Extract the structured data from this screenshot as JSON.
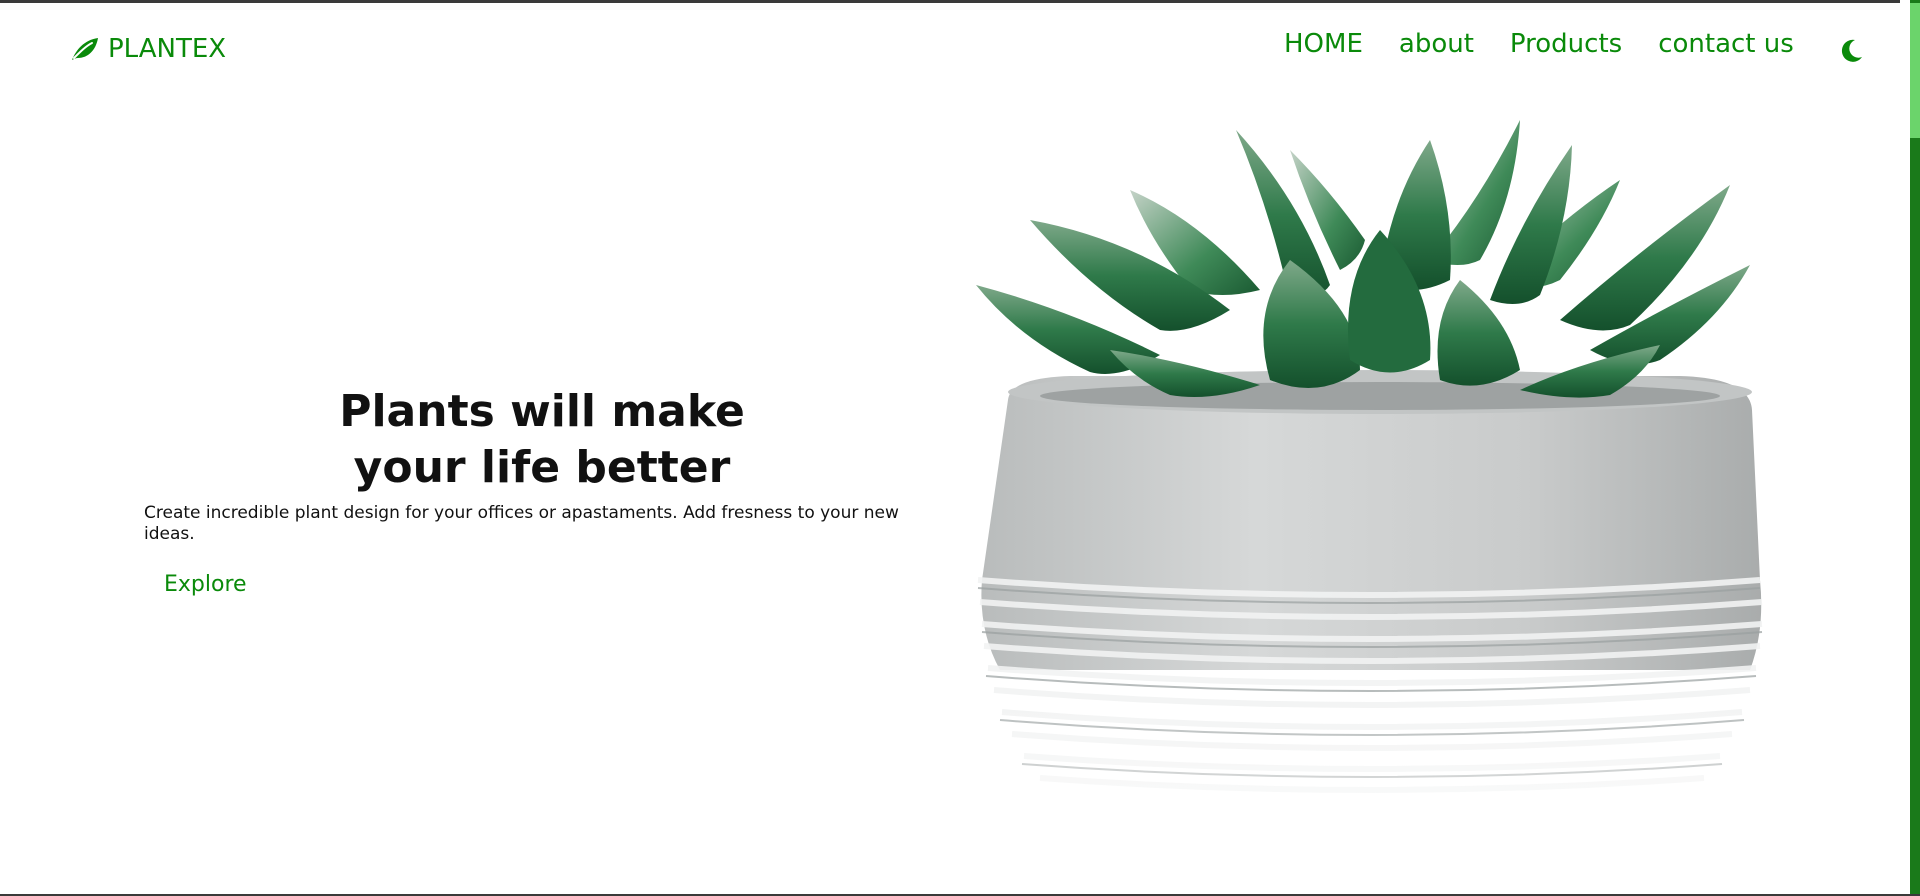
{
  "brand": {
    "name": "PLANTEX",
    "icon": "leaf-icon",
    "color": "#0a8a0a"
  },
  "nav": {
    "items": [
      {
        "label": "HOME"
      },
      {
        "label": "about"
      },
      {
        "label": "Products"
      },
      {
        "label": "contact us"
      }
    ],
    "theme_toggle_icon": "moon-icon"
  },
  "hero": {
    "title_line1": "Plants will make",
    "title_line2": "your life better",
    "description": "Create incredible plant design for your offices or apastaments. Add fresness to your new ideas.",
    "button_label": "Explore"
  },
  "image": {
    "subject": "succulent-in-concrete-pot"
  }
}
